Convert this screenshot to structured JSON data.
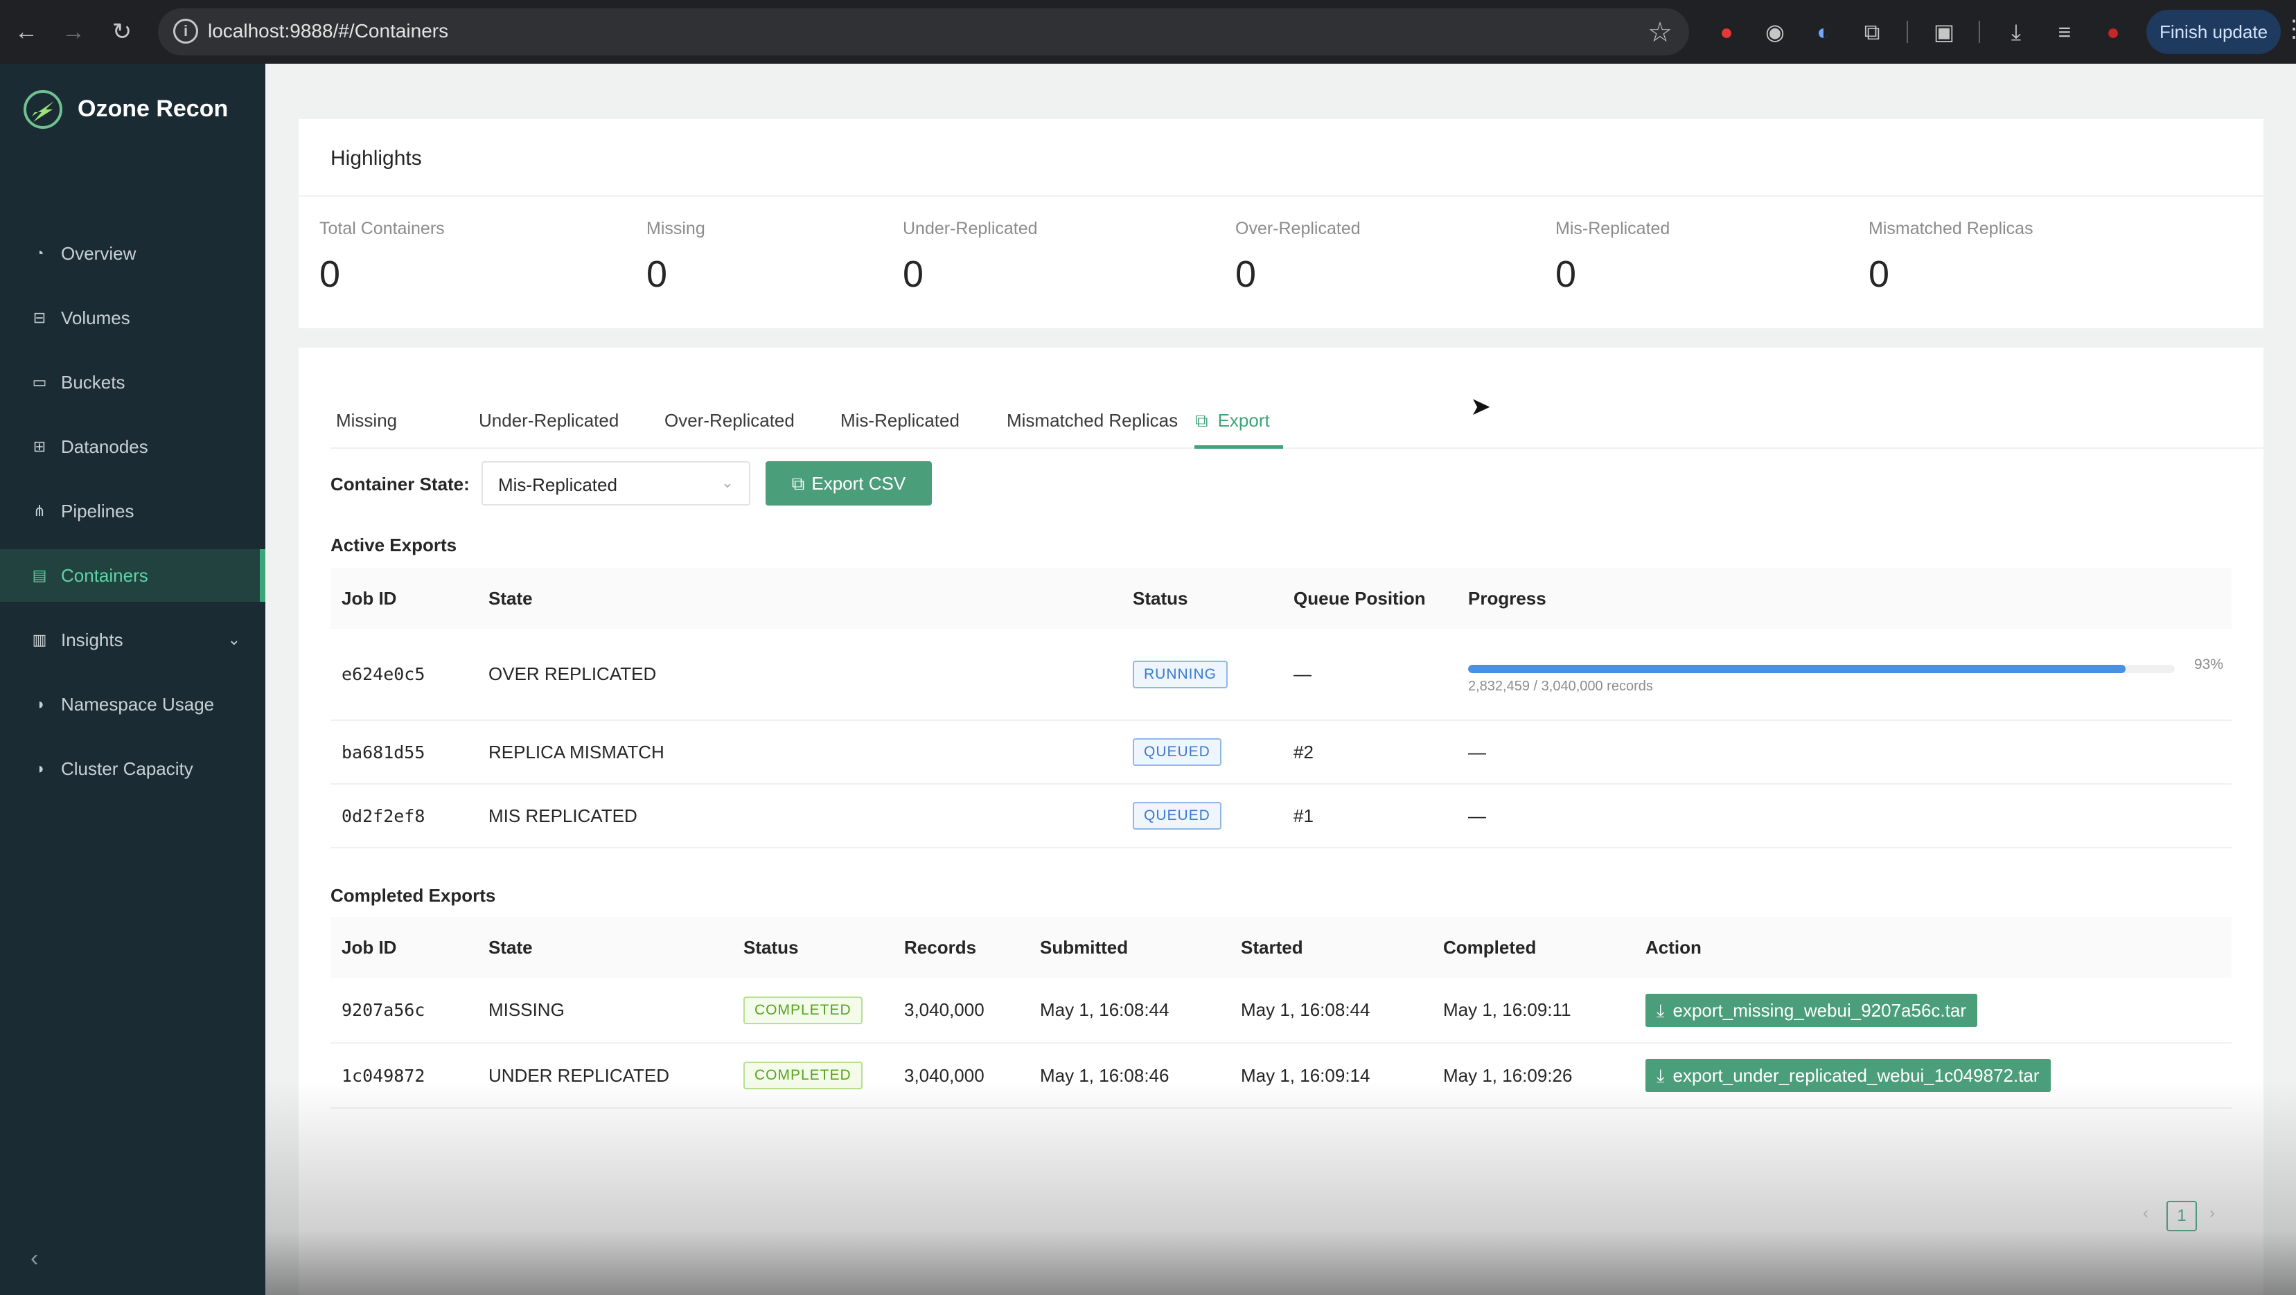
{
  "browser": {
    "url": "localhost:9888/#/Containers",
    "finish_update": "Finish update"
  },
  "sidebar": {
    "brand": "Ozone Recon",
    "items": [
      {
        "label": "Overview",
        "icon": "dashboard-icon"
      },
      {
        "label": "Volumes",
        "icon": "inbox-icon"
      },
      {
        "label": "Buckets",
        "icon": "folder-open-icon"
      },
      {
        "label": "Datanodes",
        "icon": "cluster-icon"
      },
      {
        "label": "Pipelines",
        "icon": "deployment-unit-icon"
      },
      {
        "label": "Containers",
        "icon": "container-icon",
        "active": true
      },
      {
        "label": "Insights",
        "icon": "bar-chart-icon",
        "expandable": true
      },
      {
        "label": "Namespace Usage",
        "icon": "pie-chart-icon"
      },
      {
        "label": "Cluster Capacity",
        "icon": "pie-chart-icon"
      }
    ]
  },
  "highlights": {
    "title": "Highlights",
    "stats": [
      {
        "label": "Total Containers",
        "value": "0"
      },
      {
        "label": "Missing",
        "value": "0"
      },
      {
        "label": "Under-Replicated",
        "value": "0"
      },
      {
        "label": "Over-Replicated",
        "value": "0"
      },
      {
        "label": "Mis-Replicated",
        "value": "0"
      },
      {
        "label": "Mismatched Replicas",
        "value": "0"
      }
    ]
  },
  "tabs": [
    "Missing",
    "Under-Replicated",
    "Over-Replicated",
    "Mis-Replicated",
    "Mismatched Replicas",
    "Export"
  ],
  "active_tab": "Export",
  "export": {
    "container_state_label": "Container State:",
    "container_state_value": "Mis-Replicated",
    "export_button": "Export CSV"
  },
  "active_exports": {
    "title": "Active Exports",
    "columns": [
      "Job ID",
      "State",
      "Status",
      "Queue Position",
      "Progress"
    ],
    "rows": [
      {
        "job_id": "e624e0c5",
        "state": "OVER REPLICATED",
        "status": "RUNNING",
        "queue": "—",
        "progress_pct": "93%",
        "progress_value": 0.93,
        "records": "2,832,459 / 3,040,000 records"
      },
      {
        "job_id": "ba681d55",
        "state": "REPLICA MISMATCH",
        "status": "QUEUED",
        "queue": "#2",
        "progress_text": "—"
      },
      {
        "job_id": "0d2f2ef8",
        "state": "MIS REPLICATED",
        "status": "QUEUED",
        "queue": "#1",
        "progress_text": "—"
      }
    ]
  },
  "completed_exports": {
    "title": "Completed Exports",
    "columns": [
      "Job ID",
      "State",
      "Status",
      "Records",
      "Submitted",
      "Started",
      "Completed",
      "Action"
    ],
    "rows": [
      {
        "job_id": "9207a56c",
        "state": "MISSING",
        "status": "COMPLETED",
        "records": "3,040,000",
        "submitted": "May 1, 16:08:44",
        "started": "May 1, 16:08:44",
        "completed": "May 1, 16:09:11",
        "action": "export_missing_webui_9207a56c.tar"
      },
      {
        "job_id": "1c049872",
        "state": "UNDER REPLICATED",
        "status": "COMPLETED",
        "records": "3,040,000",
        "submitted": "May 1, 16:08:46",
        "started": "May 1, 16:09:14",
        "completed": "May 1, 16:09:26",
        "action": "export_under_replicated_webui_1c049872.tar"
      }
    ]
  },
  "pagination": {
    "current": "1"
  },
  "colors": {
    "accent": "#3da57a",
    "sidebar": "#1a2b33",
    "progress": "#4a90e2"
  }
}
